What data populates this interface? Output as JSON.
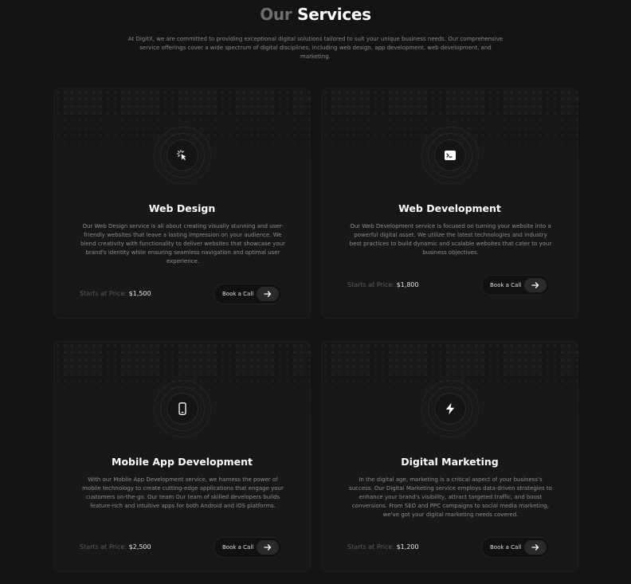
{
  "header": {
    "title_part1": "Our",
    "title_part2": "Services",
    "intro": "At DigitX, we are committed to providing exceptional digital solutions tailored to suit your unique business needs. Our comprehensive service offerings cover a wide spectrum of digital disciplines, including web design, app development, web development, and marketing."
  },
  "cards": [
    {
      "icon": "cursor-click-icon",
      "title": "Web Design",
      "description": "Our Web Design service is all about creating visually stunning and user-friendly websites that leave a lasting impression on your audience. We blend creativity with functionality to deliver websites that showcase your brand's identity while ensuring seamless navigation and optimal user experience.",
      "price_label": "Starts at Price:",
      "price_value": "$1,500",
      "button_label": "Book a Call"
    },
    {
      "icon": "terminal-icon",
      "title": "Web Development",
      "description": "Our Web Development service is focused on turning your website into a powerful digital asset. We utilize the latest technologies and industry best practices to build dynamic and scalable websites that cater to your business objectives.",
      "price_label": "Starts at Price:",
      "price_value": "$1,800",
      "button_label": "Book a Call"
    },
    {
      "icon": "mobile-phone-icon",
      "title": "Mobile App Development",
      "description": "With our Mobile App Development service, we harness the power of mobile technology to create cutting-edge applications that engage your customers on-the-go. Our team Our team of skilled developers builds feature-rich and intuitive apps for both Android and iOS platforms.",
      "price_label": "Starts at Price:",
      "price_value": "$2,500",
      "button_label": "Book a Call"
    },
    {
      "icon": "lightning-bolt-icon",
      "title": "Digital Marketing",
      "description": "In the digital age, marketing is a critical aspect of your business's success. Our Digital Marketing service employs data-driven strategies to enhance your brand's visibility, attract targeted traffic, and boost conversions. From SEO and PPC campaigns to social media marketing, we've got your digital marketing needs covered.",
      "price_label": "Starts at Price:",
      "price_value": "$1,200",
      "button_label": "Book a Call"
    }
  ]
}
